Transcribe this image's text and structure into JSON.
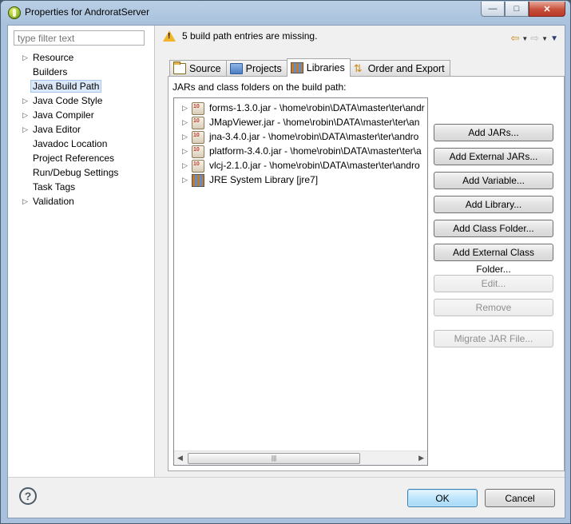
{
  "window": {
    "title": "Properties for AndroratServer"
  },
  "filter": {
    "placeholder": "type filter text"
  },
  "tree": [
    {
      "label": "Resource",
      "expandable": true
    },
    {
      "label": "Builders",
      "expandable": false
    },
    {
      "label": "Java Build Path",
      "expandable": false,
      "selected": true
    },
    {
      "label": "Java Code Style",
      "expandable": true
    },
    {
      "label": "Java Compiler",
      "expandable": true
    },
    {
      "label": "Java Editor",
      "expandable": true
    },
    {
      "label": "Javadoc Location",
      "expandable": false
    },
    {
      "label": "Project References",
      "expandable": false
    },
    {
      "label": "Run/Debug Settings",
      "expandable": false
    },
    {
      "label": "Task Tags",
      "expandable": false
    },
    {
      "label": "Validation",
      "expandable": true
    }
  ],
  "message": "5 build path entries are missing.",
  "tabs": [
    {
      "label": "Source",
      "icon": "source-folder-icon"
    },
    {
      "label": "Projects",
      "icon": "projects-icon"
    },
    {
      "label": "Libraries",
      "icon": "libraries-icon",
      "active": true
    },
    {
      "label": "Order and Export",
      "icon": "order-export-icon"
    }
  ],
  "panel_label": "JARs and class folders on the build path:",
  "entries": [
    {
      "label": "forms-1.3.0.jar - \\home\\robin\\DATA\\master\\ter\\andr",
      "icon": "jar-icon"
    },
    {
      "label": "JMapViewer.jar - \\home\\robin\\DATA\\master\\ter\\an",
      "icon": "jar-icon"
    },
    {
      "label": "jna-3.4.0.jar - \\home\\robin\\DATA\\master\\ter\\andro",
      "icon": "jar-icon"
    },
    {
      "label": "platform-3.4.0.jar - \\home\\robin\\DATA\\master\\ter\\a",
      "icon": "jar-icon"
    },
    {
      "label": "vlcj-2.1.0.jar - \\home\\robin\\DATA\\master\\ter\\andro",
      "icon": "jar-icon"
    },
    {
      "label": "JRE System Library [jre7]",
      "icon": "jre-library-icon"
    }
  ],
  "buttons": {
    "add_jars": "Add JARs...",
    "add_external_jars": "Add External JARs...",
    "add_variable": "Add Variable...",
    "add_library": "Add Library...",
    "add_class_folder": "Add Class Folder...",
    "add_external_class_folder": "Add External Class Folder...",
    "edit": "Edit...",
    "remove": "Remove",
    "migrate": "Migrate JAR File..."
  },
  "dialog": {
    "ok": "OK",
    "cancel": "Cancel"
  }
}
